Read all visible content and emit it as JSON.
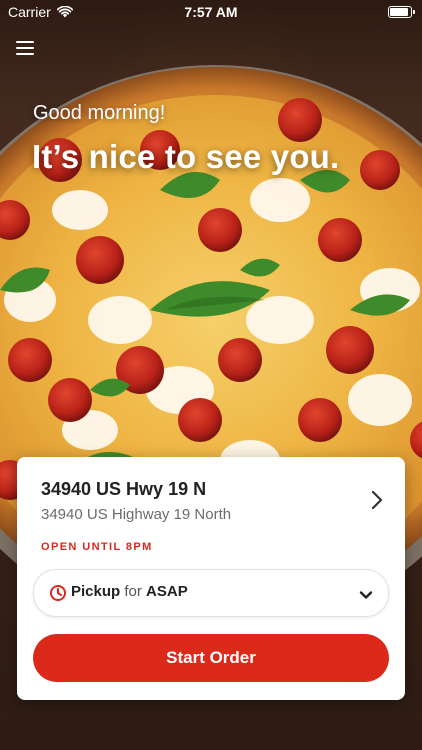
{
  "status_bar": {
    "carrier": "Carrier",
    "time": "7:57 AM",
    "battery_level": 0.95
  },
  "header": {
    "menu_icon": "hamburger-menu-icon"
  },
  "hero": {
    "greeting": "Good morning!",
    "headline": "It’s nice to see you."
  },
  "location": {
    "name": "34940 US Hwy 19 N",
    "address": "34940 US Highway 19 North",
    "hours": "OPEN UNTIL 8PM",
    "chevron_icon": "chevron-right-icon"
  },
  "order_mode": {
    "clock_icon": "clock-icon",
    "mode": "Pickup",
    "connector": "for",
    "time": "ASAP",
    "dropdown_icon": "chevron-down-icon"
  },
  "actions": {
    "start_order": "Start Order"
  },
  "colors": {
    "accent": "#dc2a1a",
    "hours_text": "#d52b1e"
  }
}
